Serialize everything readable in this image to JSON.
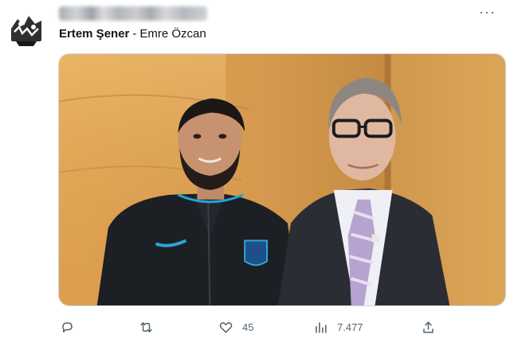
{
  "tweet": {
    "name_obscured": "",
    "text": {
      "player": "Ertem Şener",
      "separator": "-",
      "author": "Emre Özcan"
    },
    "more_icon": "more-horizontal-icon"
  },
  "actions": {
    "reply": {
      "icon": "reply-icon",
      "count": ""
    },
    "retweet": {
      "icon": "retweet-icon",
      "count": ""
    },
    "like": {
      "icon": "like-icon",
      "count": "45"
    },
    "views": {
      "icon": "views-icon",
      "count": "7.477"
    },
    "share": {
      "icon": "share-icon",
      "count": ""
    }
  },
  "colors": {
    "icon_gray": "#536471",
    "text": "#0f1419",
    "card_border": "#cfd9de"
  }
}
